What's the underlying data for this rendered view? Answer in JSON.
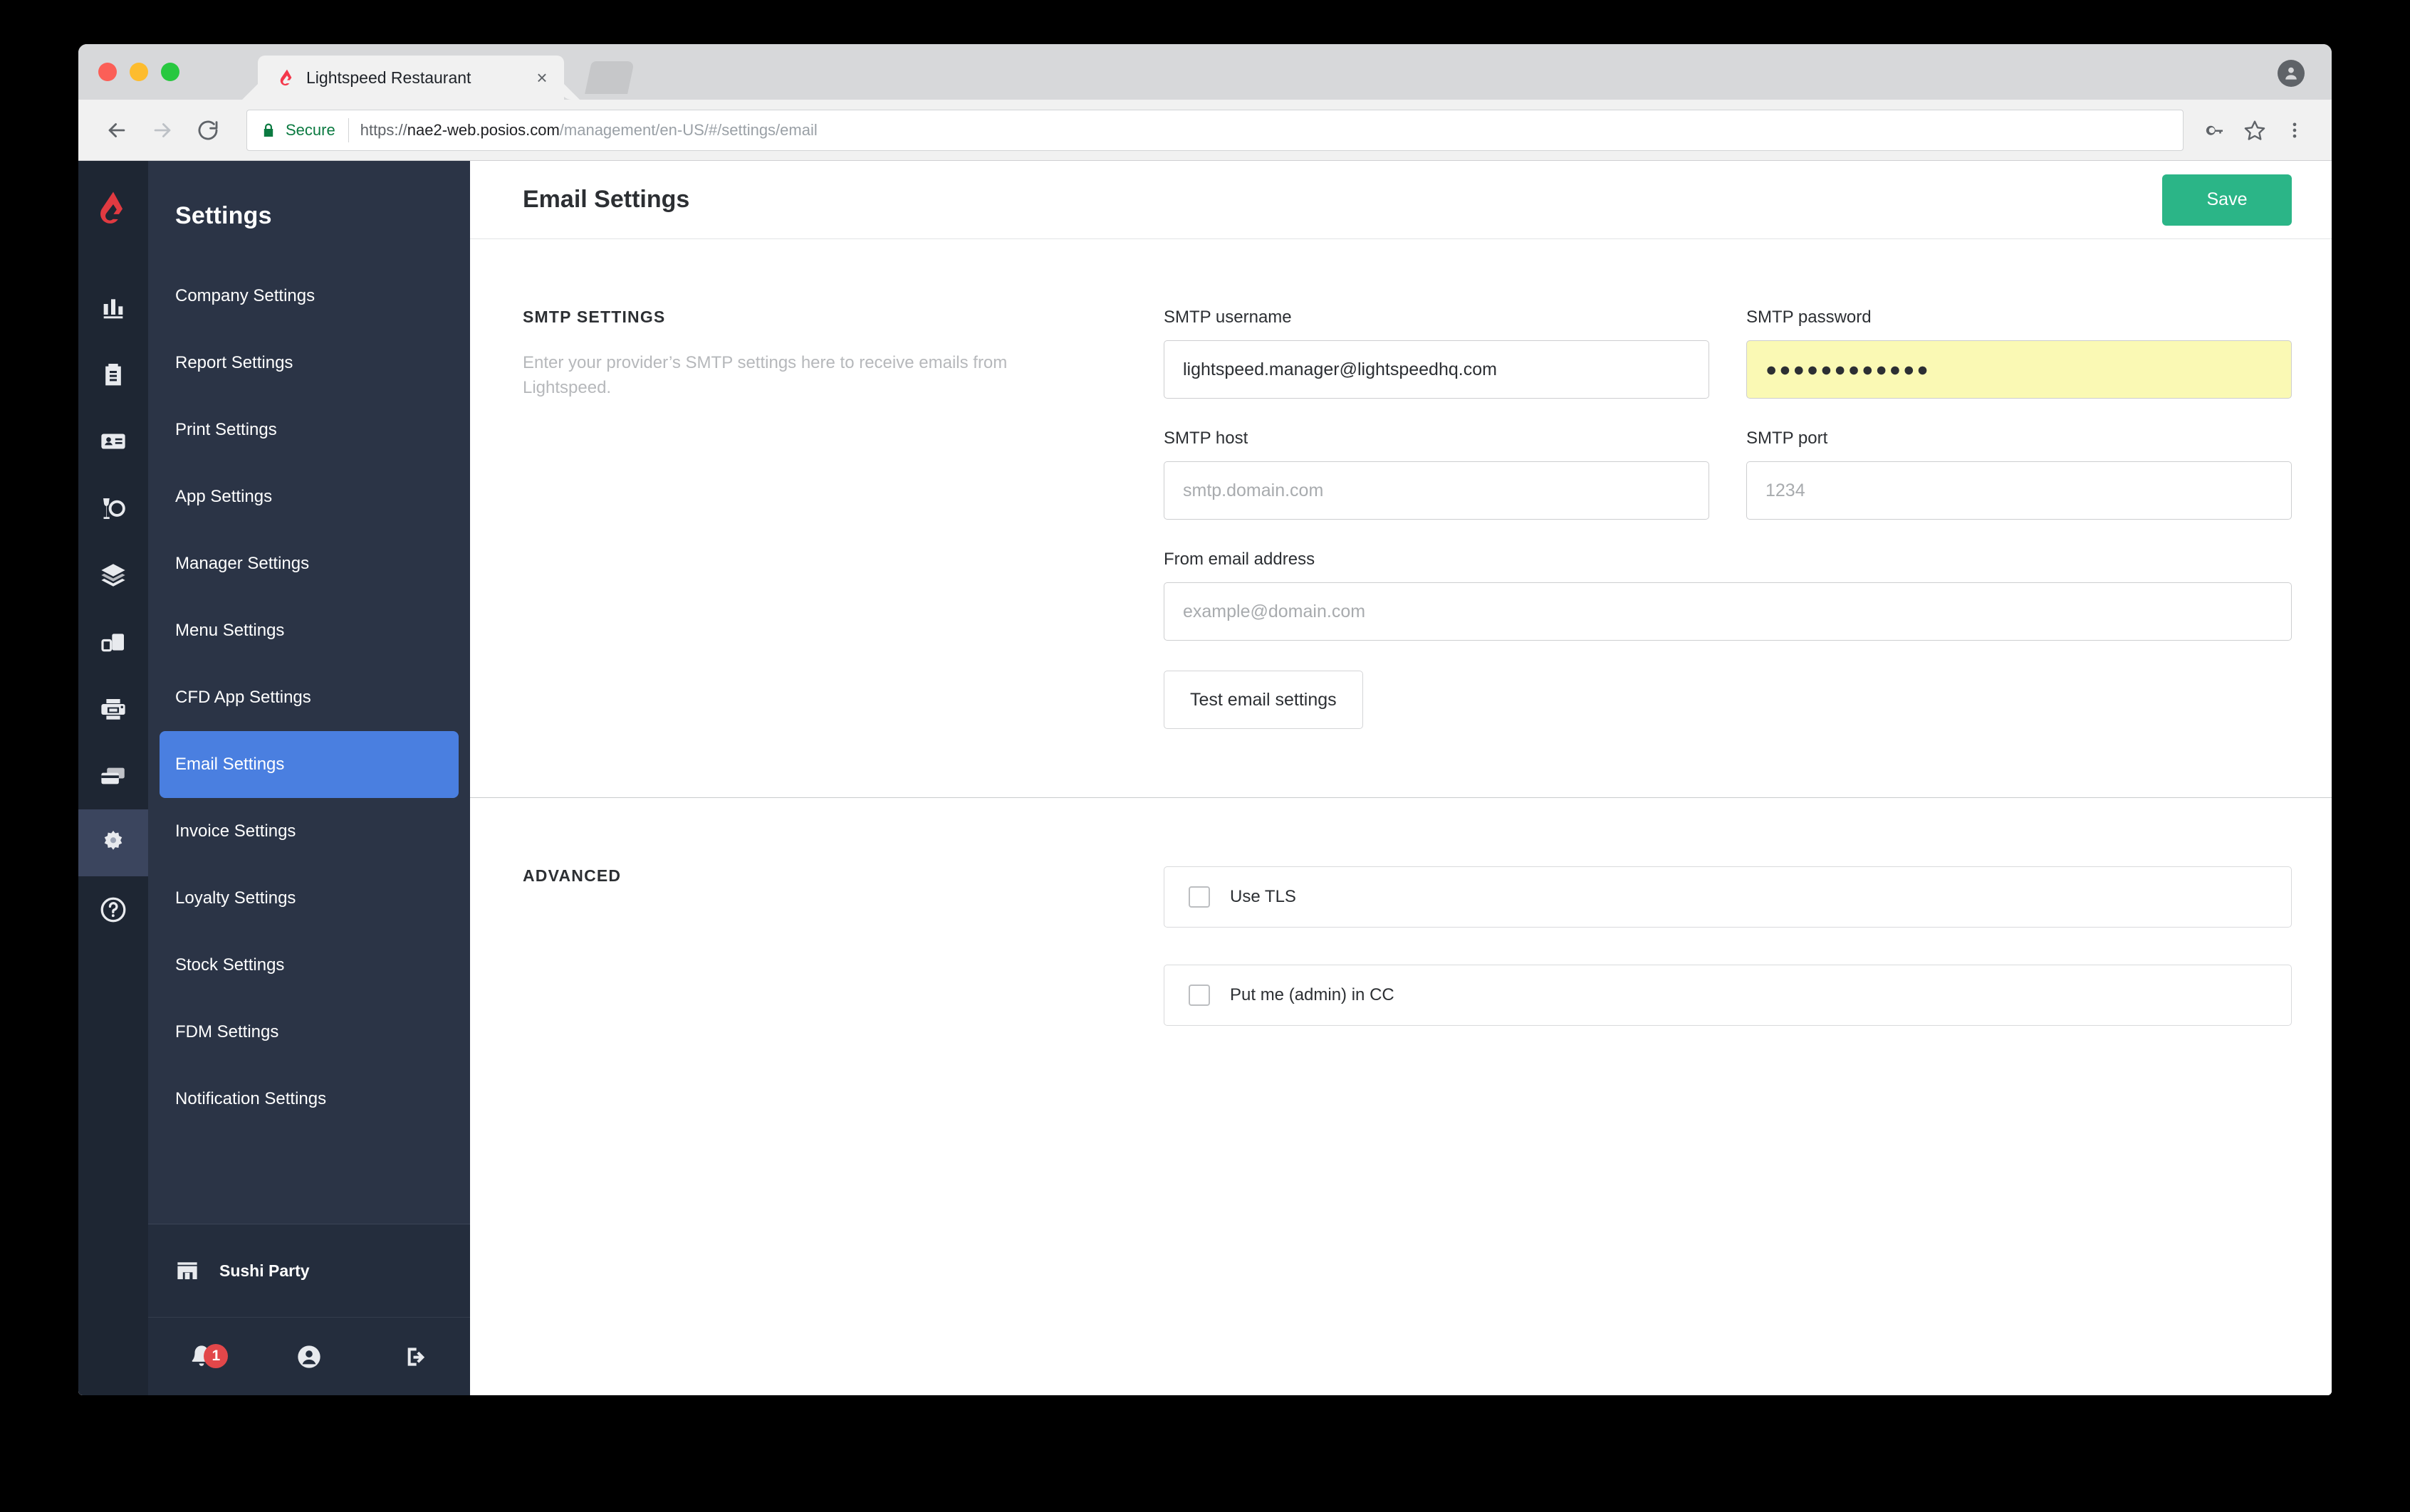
{
  "browser": {
    "tab": {
      "title": "Lightspeed Restaurant",
      "close_label": "×"
    },
    "omnibox": {
      "security_label": "Secure",
      "url_scheme": "https://",
      "url_host": "nae2-web.posios.com",
      "url_path": "/management/en-US/#/settings/email"
    }
  },
  "sidebar": {
    "title": "Settings",
    "items": [
      {
        "label": "Company Settings",
        "active": false
      },
      {
        "label": "Report Settings",
        "active": false
      },
      {
        "label": "Print Settings",
        "active": false
      },
      {
        "label": "App Settings",
        "active": false
      },
      {
        "label": "Manager Settings",
        "active": false
      },
      {
        "label": "Menu Settings",
        "active": false
      },
      {
        "label": "CFD App Settings",
        "active": false
      },
      {
        "label": "Email Settings",
        "active": true
      },
      {
        "label": "Invoice Settings",
        "active": false
      },
      {
        "label": "Loyalty Settings",
        "active": false
      },
      {
        "label": "Stock Settings",
        "active": false
      },
      {
        "label": "FDM Settings",
        "active": false
      },
      {
        "label": "Notification Settings",
        "active": false
      }
    ],
    "store_name": "Sushi Party",
    "notification_badge": "1"
  },
  "header": {
    "title": "Email Settings",
    "save_label": "Save"
  },
  "smtp_section": {
    "label": "SMTP SETTINGS",
    "description": "Enter your provider’s SMTP settings here to receive emails from Lightspeed.",
    "username_label": "SMTP username",
    "username_value": "lightspeed.manager@lightspeedhq.com",
    "password_label": "SMTP password",
    "password_value": "●●●●●●●●●●●●",
    "host_label": "SMTP host",
    "host_placeholder": "smtp.domain.com",
    "host_value": "",
    "port_label": "SMTP port",
    "port_placeholder": "1234",
    "port_value": "",
    "from_label": "From email address",
    "from_placeholder": "example@domain.com",
    "from_value": "",
    "test_button_label": "Test email settings"
  },
  "advanced_section": {
    "label": "ADVANCED",
    "options": [
      {
        "label": "Use TLS",
        "checked": false
      },
      {
        "label": "Put me (admin) in CC",
        "checked": false
      }
    ]
  },
  "colors": {
    "accent_blue": "#4a7fe0",
    "save_green": "#2bb587",
    "brand_red": "#e2474a",
    "autofill_yellow": "#faf9b4",
    "rail_dark": "#1e2633",
    "nav_dark": "#2b3446"
  }
}
